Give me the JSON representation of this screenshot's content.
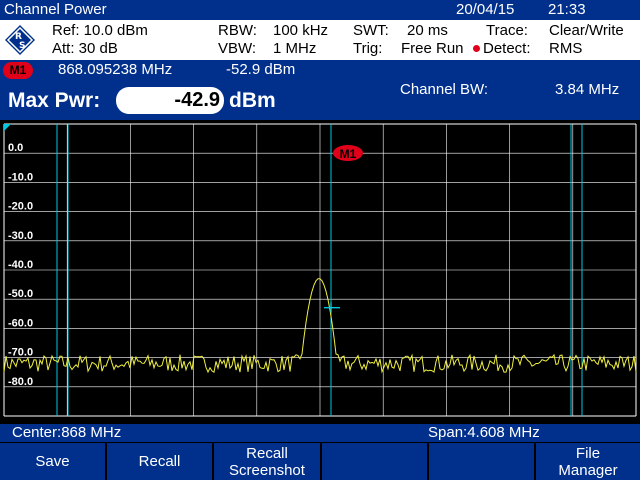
{
  "title_bar": {
    "mode": "Channel Power",
    "date": "20/04/15",
    "time": "21:33"
  },
  "settings": {
    "ref": "Ref:  10.0 dBm",
    "att": "Att:  30 dB",
    "rbw_label": "RBW:",
    "rbw_value": "100 kHz",
    "vbw_label": "VBW:",
    "vbw_value": "1 MHz",
    "swt_label": "SWT:",
    "swt_value": "20 ms",
    "trig_label": "Trig:",
    "trig_value": "Free Run",
    "trace_label": "Trace:",
    "trace_value": "Clear/Write",
    "detect_label": "Detect:",
    "detect_value": "RMS"
  },
  "marker": {
    "badge": "M1",
    "frequency": "868.095238  MHz",
    "level": "-52.9  dBm"
  },
  "result": {
    "label": "Max Pwr:",
    "value": "-42.9",
    "unit": "dBm",
    "bw_label": "Channel BW:",
    "bw_value": "3.84 MHz"
  },
  "graph": {
    "y_ticks": [
      "0.0",
      "-10.0",
      "-20.0",
      "-30.0",
      "-40.0",
      "-50.0",
      "-60.0",
      "-70.0",
      "-80.0"
    ],
    "marker_badge": "M1",
    "colors": {
      "trace": "#f0f040",
      "grid": "#ffffff",
      "channel_lines": "#00c8e0"
    }
  },
  "status": {
    "center": "Center:868 MHz",
    "span": "Span:4.608 MHz"
  },
  "softkeys": [
    {
      "line1": "Save",
      "line2": ""
    },
    {
      "line1": "Recall",
      "line2": ""
    },
    {
      "line1": "Recall",
      "line2": "Screenshot"
    },
    {
      "line1": "",
      "line2": ""
    },
    {
      "line1": "",
      "line2": ""
    },
    {
      "line1": "File",
      "line2": "Manager"
    }
  ]
}
